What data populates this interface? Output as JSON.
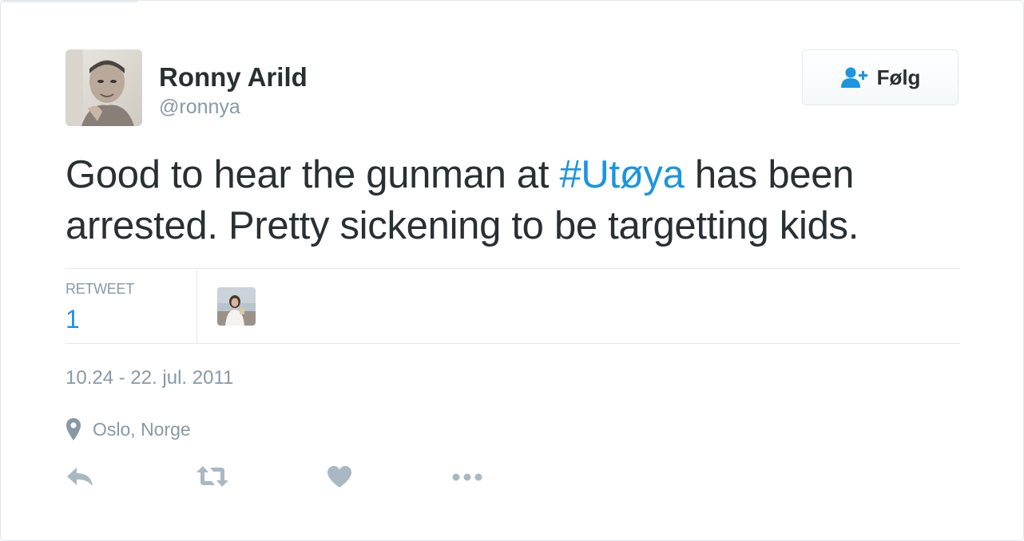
{
  "author": {
    "name": "Ronny Arild",
    "handle": "@ronnya"
  },
  "follow_button": {
    "label": "Følg",
    "icon": "follow-user-icon"
  },
  "tweet": {
    "text_before": "Good to hear the gunman at ",
    "hashtag": "#Utøya",
    "text_after": " has been arrested. Pretty sickening to be targetting kids."
  },
  "stats": {
    "retweet_label": "RETWEET",
    "retweet_count": "1"
  },
  "timestamp": "10.24 - 22. jul. 2011",
  "location": {
    "icon": "location-pin-icon",
    "text": "Oslo, Norge"
  },
  "actions": [
    {
      "name": "reply",
      "icon": "reply-icon"
    },
    {
      "name": "retweet",
      "icon": "retweet-icon"
    },
    {
      "name": "like",
      "icon": "heart-icon"
    },
    {
      "name": "more",
      "icon": "more-dots-icon"
    }
  ],
  "colors": {
    "link": "#1b95e0",
    "muted": "#8899a6",
    "text": "#292f33",
    "border": "#e1e8ed",
    "icon": "#aab8c2"
  }
}
